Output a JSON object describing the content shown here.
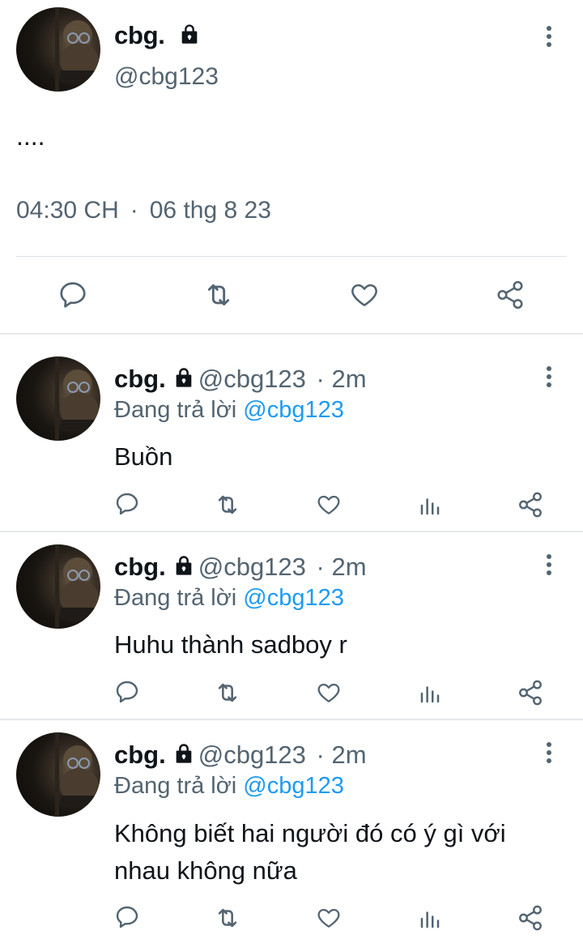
{
  "main_tweet": {
    "display_name": "cbg.",
    "handle": "@cbg123",
    "text": "....",
    "time": "04:30 CH",
    "date": "06 thg 8 23",
    "separator": "·"
  },
  "replies": [
    {
      "display_name": "cbg.",
      "handle": "@cbg123",
      "dot": "·",
      "age": "2m",
      "replying_prefix": "Đang trả lời",
      "replying_to": "@cbg123",
      "text": "Buồn"
    },
    {
      "display_name": "cbg.",
      "handle": "@cbg123",
      "dot": "·",
      "age": "2m",
      "replying_prefix": "Đang trả lời",
      "replying_to": "@cbg123",
      "text": "Huhu thành sadboy r"
    },
    {
      "display_name": "cbg.",
      "handle": "@cbg123",
      "dot": "·",
      "age": "2m",
      "replying_prefix": "Đang trả lời",
      "replying_to": "@cbg123",
      "text": "Không biết hai người đó có ý gì với nhau không nữa"
    }
  ],
  "colors": {
    "text": "#0f1419",
    "secondary": "#536471",
    "link": "#1d9bf0",
    "divider": "#dfe3e6"
  },
  "icons": [
    "lock-icon",
    "more-icon",
    "reply-icon",
    "retweet-icon",
    "like-icon",
    "views-icon",
    "share-icon"
  ]
}
